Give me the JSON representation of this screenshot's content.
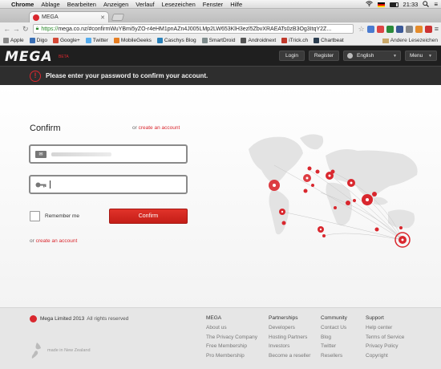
{
  "menubar": {
    "items": [
      "Chrome",
      "Ablage",
      "Bearbeiten",
      "Anzeigen",
      "Verlauf",
      "Lesezeichen",
      "Fenster",
      "Hilfe"
    ],
    "time": "21:33"
  },
  "tab": {
    "title": "MEGA"
  },
  "address": {
    "scheme": "https://",
    "url": "mega.co.nz/#confirmWuYBmi5yZO-r4eHM1pnAZn4J005LMp2LW653KlH3ezl5ZbvXRAEATs0zB3Og3ItqY2Z..."
  },
  "bookmarks": {
    "items": [
      {
        "label": "Apple",
        "color": "#888888"
      },
      {
        "label": "Digo",
        "color": "#3a6fb5"
      },
      {
        "label": "Google+",
        "color": "#d34836"
      },
      {
        "label": "Twitter",
        "color": "#55acee"
      },
      {
        "label": "MobileGeeks",
        "color": "#e67e22"
      },
      {
        "label": "Caschys Blog",
        "color": "#2980b9"
      },
      {
        "label": "SmartDroid",
        "color": "#7f8c8d"
      },
      {
        "label": "Androidnext",
        "color": "#555555"
      },
      {
        "label": "iTrick.ch",
        "color": "#c0392b"
      },
      {
        "label": "Chartbeat",
        "color": "#2c3e50"
      }
    ],
    "other": "Andere Lesezeichen"
  },
  "header": {
    "logo": "MEGA",
    "beta": "BETA",
    "login": "Login",
    "register": "Register",
    "language": "English",
    "menu": "Menu"
  },
  "notice": {
    "icon": "!",
    "text": "Please enter your password to confirm your account."
  },
  "form": {
    "title": "Confirm",
    "or_text": "or",
    "create_account": "create an account",
    "email_value": "",
    "password_placeholder": "",
    "remember": "Remember me",
    "confirm_button": "Confirm"
  },
  "footer": {
    "copyright_brand": "Mega Limited 2013",
    "copyright_rest": "All rights reserved",
    "made_in": "made in New Zealand",
    "columns": [
      {
        "heading": "MEGA",
        "links": [
          "About us",
          "The Privacy Company",
          "Free Membership",
          "Pro Membership"
        ]
      },
      {
        "heading": "Partnerships",
        "links": [
          "Developers",
          "Hosting Partners",
          "Investors",
          "Become a reseller"
        ]
      },
      {
        "heading": "Community",
        "links": [
          "Contact Us",
          "Blog",
          "Twitter",
          "Resellers"
        ]
      },
      {
        "heading": "Support",
        "links": [
          "Help center",
          "Terms of Service",
          "Privacy Policy",
          "Copyright"
        ]
      }
    ]
  },
  "colors": {
    "accent": "#d9272e",
    "header_bg": "#1f1f1f",
    "notice_bg": "#2e2e2e"
  }
}
